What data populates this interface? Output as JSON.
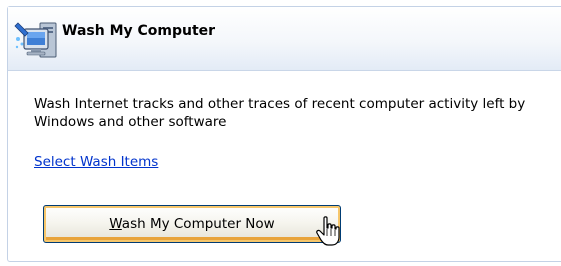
{
  "panel": {
    "icon": "computer-wash-icon",
    "title": "Wash My Computer",
    "description": "Wash Internet tracks and other traces of recent computer activity left by Windows and other software",
    "link_label": "Select Wash Items"
  },
  "button": {
    "mnemonic": "W",
    "label_rest": "ash My Computer Now"
  },
  "cursor": {
    "icon": "hand-pointer-cursor-icon"
  },
  "colors": {
    "link": "#0033cc",
    "panel_border": "#c4d2e6",
    "button_border": "#003c74",
    "button_hover_glow": "#f6c66b"
  }
}
